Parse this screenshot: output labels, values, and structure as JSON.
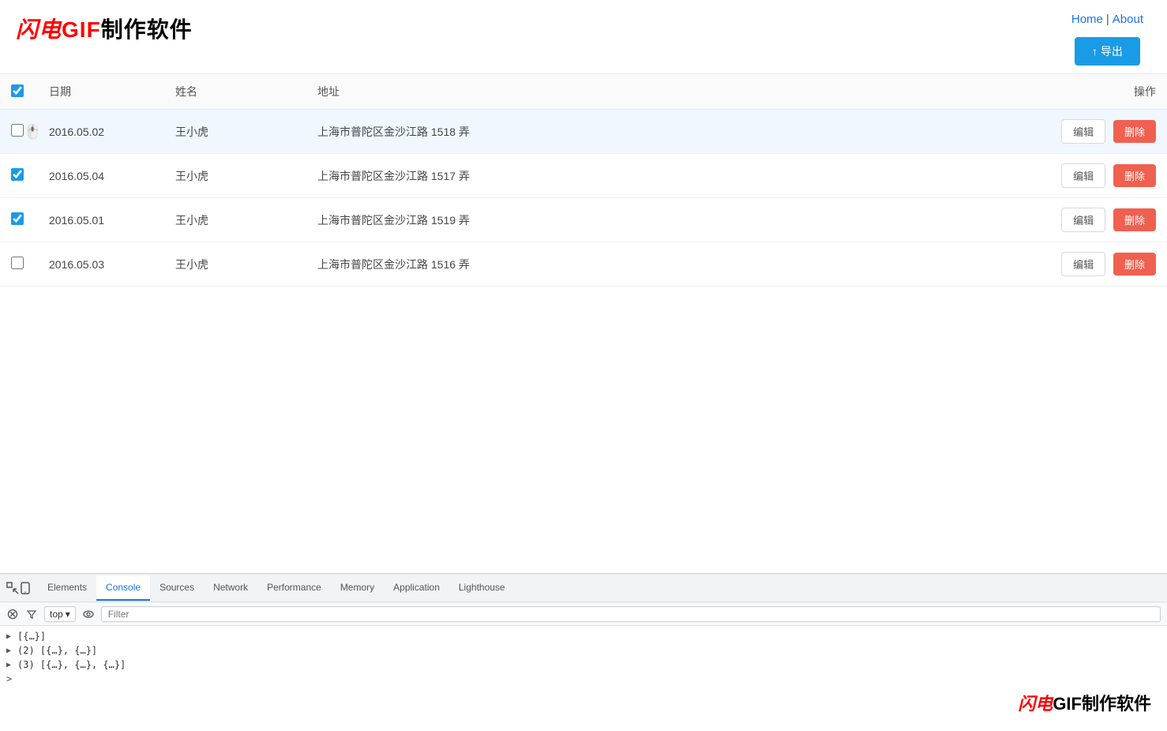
{
  "header": {
    "logo": "闪电GIF制作软件",
    "logo_parts": {
      "flash": "闪电",
      "gif": "GIF",
      "rest": "制作软件"
    },
    "nav": {
      "home_label": "Home",
      "separator": "|",
      "about_label": "About"
    },
    "export_button": "↑ 导出"
  },
  "table": {
    "columns": {
      "date": "日期",
      "name": "姓名",
      "address": "地址",
      "operation": "操作"
    },
    "rows": [
      {
        "id": 1,
        "date": "2016.05.02",
        "name": "王小虎",
        "address": "上海市普陀区金沙江路 1518 弄",
        "checked": false,
        "edit_label": "编辑",
        "delete_label": "删除"
      },
      {
        "id": 2,
        "date": "2016.05.04",
        "name": "王小虎",
        "address": "上海市普陀区金沙江路 1517 弄",
        "checked": true,
        "edit_label": "编辑",
        "delete_label": "删除"
      },
      {
        "id": 3,
        "date": "2016.05.01",
        "name": "王小虎",
        "address": "上海市普陀区金沙江路 1519 弄",
        "checked": true,
        "edit_label": "编辑",
        "delete_label": "删除"
      },
      {
        "id": 4,
        "date": "2016.05.03",
        "name": "王小虎",
        "address": "上海市普陀区金沙江路 1516 弄",
        "checked": false,
        "edit_label": "编辑",
        "delete_label": "删除"
      }
    ],
    "header_checkbox_checked": true
  },
  "devtools": {
    "tabs": [
      "Elements",
      "Console",
      "Sources",
      "Network",
      "Performance",
      "Memory",
      "Application",
      "Lighthouse"
    ],
    "active_tab": "Console",
    "toolbar": {
      "top_label": "top",
      "filter_placeholder": "Filter"
    },
    "console_lines": [
      "▶ [{…}]",
      "▶ (2) [{…}, {…}]",
      "▶ (3) [{…}, {…}, {…}]"
    ]
  },
  "watermark": {
    "flash": "闪电",
    "gif": "GIF",
    "rest": "制作软件"
  }
}
